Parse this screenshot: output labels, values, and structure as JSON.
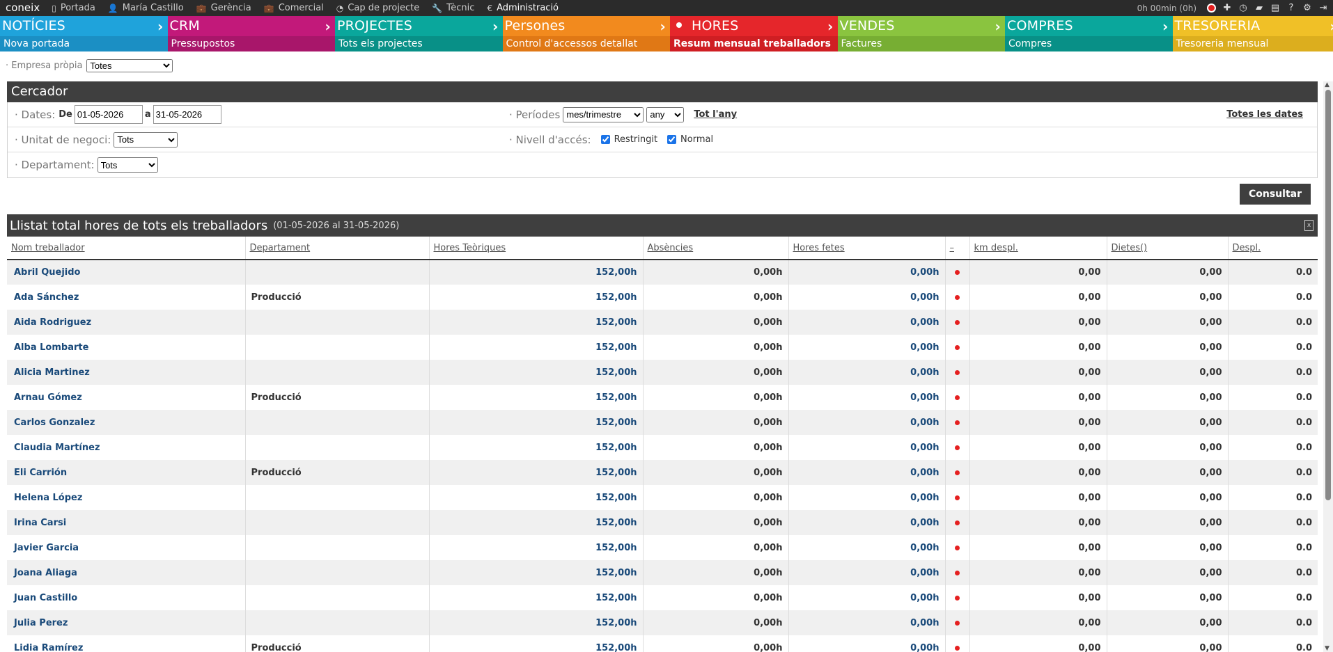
{
  "topbar": {
    "brand": "coneix",
    "nav": [
      {
        "icon": "page-icon",
        "glyph": "▯",
        "label": "Portada"
      },
      {
        "icon": "user-icon",
        "glyph": "👤",
        "label": "María Castillo"
      },
      {
        "icon": "briefcase-icon",
        "glyph": "💼",
        "label": "Gerència"
      },
      {
        "icon": "briefcase-icon",
        "glyph": "💼",
        "label": "Comercial"
      },
      {
        "icon": "pie-chart-icon",
        "glyph": "◔",
        "label": "Cap de projecte"
      },
      {
        "icon": "wrench-icon",
        "glyph": "🔧",
        "label": "Tècnic"
      },
      {
        "icon": "euro-icon",
        "glyph": "€",
        "label": "Administració"
      }
    ],
    "timer": "0h 00min (0h)"
  },
  "modules": [
    {
      "title": "NOTÍCIES",
      "sub": "Nova portada",
      "color_top": "#1fa3db",
      "color_sub": "#1b8fc4",
      "sub_bold": false
    },
    {
      "title": "CRM",
      "sub": "Pressupostos",
      "color_top": "#c2197a",
      "color_sub": "#a8166a",
      "sub_bold": false
    },
    {
      "title": "PROJECTES",
      "sub": "Tots els projectes",
      "color_top": "#0aa79c",
      "color_sub": "#089087",
      "sub_bold": false
    },
    {
      "title": "Persones",
      "sub": "Control d'accessos detallat",
      "color_top": "#f28a1e",
      "color_sub": "#e07815",
      "sub_bold": false
    },
    {
      "title": "HORES",
      "sub": "Resum mensual treballadors",
      "color_top": "#e5262b",
      "color_sub": "#cf1e23",
      "sub_bold": true,
      "active": true
    },
    {
      "title": "VENDES",
      "sub": "Factures",
      "color_top": "#8ac43f",
      "color_sub": "#77ae33",
      "sub_bold": false
    },
    {
      "title": "COMPRES",
      "sub": "Compres",
      "color_top": "#0aa79c",
      "color_sub": "#089087",
      "sub_bold": false
    },
    {
      "title": "TRESORERIA",
      "sub": "Tresoreria mensual",
      "color_top": "#f0c027",
      "color_sub": "#dcae1e",
      "sub_bold": false
    }
  ],
  "empresa": {
    "label": "· Empresa pròpia",
    "value": "Totes"
  },
  "cercador": {
    "title": "Cercador",
    "dates_label": "· Dates:",
    "de_label": "De",
    "date_from": "01-05-2026",
    "a_label": "a",
    "date_to": "31-05-2026",
    "periodes_label": "· Períodes",
    "periode_value": "mes/trimestre",
    "any_value": "any",
    "tot_any": "Tot l'any",
    "totes_dates": "Totes les dates",
    "unitat_label": "· Unitat de negoci:",
    "unitat_value": "Tots",
    "nivell_label": "· Nivell d'accés:",
    "restringit": "Restringit",
    "normal": "Normal",
    "departament_label": "· Departament:",
    "departament_value": "Tots",
    "consultar": "Consultar"
  },
  "listat": {
    "title": "Llistat total hores de tots els treballadors",
    "range": "(01-05-2026 al 31-05-2026)",
    "columns": [
      "Nom treballador",
      "Departament",
      "Hores Teòriques",
      "Absències",
      "Hores fetes",
      "–",
      "km despl.",
      "Dietes()",
      "Despl."
    ],
    "rows": [
      {
        "name": "Abril Quejido",
        "dept": "",
        "teo": "152,00h",
        "abs": "0,00h",
        "fetes": "0,00h",
        "km": "0,00",
        "dietes": "0,00",
        "despl": "0.0"
      },
      {
        "name": "Ada Sánchez",
        "dept": "Producció",
        "teo": "152,00h",
        "abs": "0,00h",
        "fetes": "0,00h",
        "km": "0,00",
        "dietes": "0,00",
        "despl": "0.0"
      },
      {
        "name": "Aida Rodriguez",
        "dept": "",
        "teo": "152,00h",
        "abs": "0,00h",
        "fetes": "0,00h",
        "km": "0,00",
        "dietes": "0,00",
        "despl": "0.0"
      },
      {
        "name": "Alba Lombarte",
        "dept": "",
        "teo": "152,00h",
        "abs": "0,00h",
        "fetes": "0,00h",
        "km": "0,00",
        "dietes": "0,00",
        "despl": "0.0"
      },
      {
        "name": "Alicia Martinez",
        "dept": "",
        "teo": "152,00h",
        "abs": "0,00h",
        "fetes": "0,00h",
        "km": "0,00",
        "dietes": "0,00",
        "despl": "0.0"
      },
      {
        "name": "Arnau Gómez",
        "dept": "Producció",
        "teo": "152,00h",
        "abs": "0,00h",
        "fetes": "0,00h",
        "km": "0,00",
        "dietes": "0,00",
        "despl": "0.0"
      },
      {
        "name": "Carlos Gonzalez",
        "dept": "",
        "teo": "152,00h",
        "abs": "0,00h",
        "fetes": "0,00h",
        "km": "0,00",
        "dietes": "0,00",
        "despl": "0.0"
      },
      {
        "name": "Claudia Martínez",
        "dept": "",
        "teo": "152,00h",
        "abs": "0,00h",
        "fetes": "0,00h",
        "km": "0,00",
        "dietes": "0,00",
        "despl": "0.0"
      },
      {
        "name": "Eli Carrión",
        "dept": "Producció",
        "teo": "152,00h",
        "abs": "0,00h",
        "fetes": "0,00h",
        "km": "0,00",
        "dietes": "0,00",
        "despl": "0.0"
      },
      {
        "name": "Helena López",
        "dept": "",
        "teo": "152,00h",
        "abs": "0,00h",
        "fetes": "0,00h",
        "km": "0,00",
        "dietes": "0,00",
        "despl": "0.0"
      },
      {
        "name": "Irina Carsi",
        "dept": "",
        "teo": "152,00h",
        "abs": "0,00h",
        "fetes": "0,00h",
        "km": "0,00",
        "dietes": "0,00",
        "despl": "0.0"
      },
      {
        "name": "Javier Garcia",
        "dept": "",
        "teo": "152,00h",
        "abs": "0,00h",
        "fetes": "0,00h",
        "km": "0,00",
        "dietes": "0,00",
        "despl": "0.0"
      },
      {
        "name": "Joana Aliaga",
        "dept": "",
        "teo": "152,00h",
        "abs": "0,00h",
        "fetes": "0,00h",
        "km": "0,00",
        "dietes": "0,00",
        "despl": "0.0"
      },
      {
        "name": "Juan Castillo",
        "dept": "",
        "teo": "152,00h",
        "abs": "0,00h",
        "fetes": "0,00h",
        "km": "0,00",
        "dietes": "0,00",
        "despl": "0.0"
      },
      {
        "name": "Julia Perez",
        "dept": "",
        "teo": "152,00h",
        "abs": "0,00h",
        "fetes": "0,00h",
        "km": "0,00",
        "dietes": "0,00",
        "despl": "0.0"
      },
      {
        "name": "Lidia Ramírez",
        "dept": "Producció",
        "teo": "152,00h",
        "abs": "0,00h",
        "fetes": "0,00h",
        "km": "0,00",
        "dietes": "0,00",
        "despl": "0.0"
      }
    ]
  }
}
